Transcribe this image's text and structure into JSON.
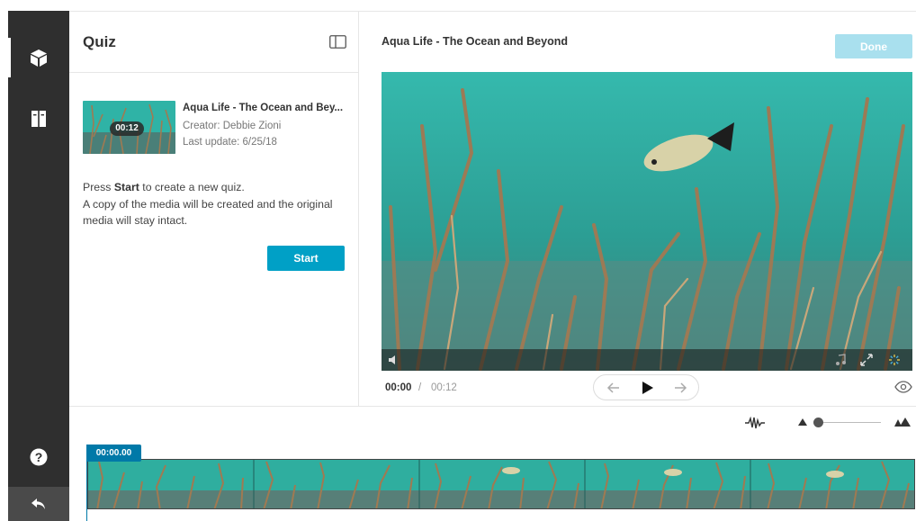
{
  "nav": {
    "items": [
      {
        "icon": "cube-icon",
        "active": true
      },
      {
        "icon": "book-icon",
        "active": false
      }
    ],
    "help_icon": "question-icon",
    "back_icon": "undo-arrow-icon"
  },
  "quiz_panel": {
    "title": "Quiz",
    "media": {
      "thumbnail_duration": "00:12",
      "name": "Aqua Life - The Ocean and Bey...",
      "creator": "Creator: Debbie Zioni",
      "last_update": "Last update: 6/25/18"
    },
    "instructions": {
      "prefix": "Press ",
      "start_word": "Start",
      "suffix": " to create a new quiz.",
      "line2": "A copy of the media will be created and the original media will stay intact."
    },
    "start_label": "Start"
  },
  "player": {
    "title": "Aqua Life - The Ocean and Beyond",
    "done_label": "Done",
    "current_time": "00:00",
    "separator": "/",
    "duration": "00:12"
  },
  "timeline": {
    "playhead_time": "00:00.00",
    "zoom_level": 0.02
  },
  "colors": {
    "accent": "#00a0c6",
    "done_disabled": "#a9e0ee",
    "playhead": "#0079a8",
    "nav_bg": "#2f2f2f"
  }
}
